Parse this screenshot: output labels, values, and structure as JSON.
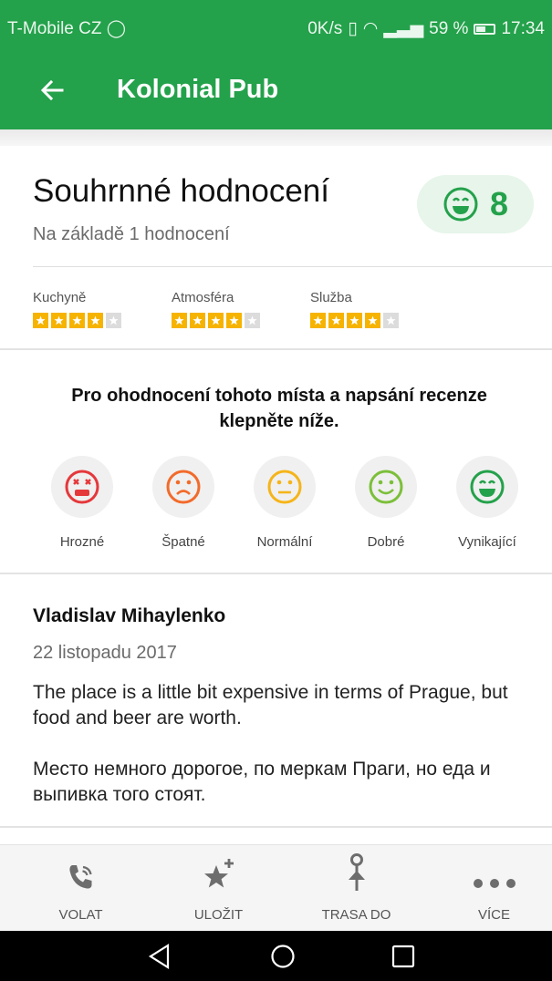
{
  "status_bar": {
    "carrier": "T-Mobile CZ",
    "right_text": "0K/s",
    "battery": "59 %",
    "time": "17:34"
  },
  "app_bar": {
    "title": "Kolonial Pub",
    "back_icon": "arrow-left-icon"
  },
  "summary": {
    "title": "Souhrnné hodnocení",
    "subtitle": "Na základě 1 hodnocení",
    "score": "8",
    "score_icon": "grinning-face-icon"
  },
  "categories": [
    {
      "label": "Kuchyně",
      "stars": 4,
      "max": 5
    },
    {
      "label": "Atmosféra",
      "stars": 4,
      "max": 5
    },
    {
      "label": "Služba",
      "stars": 4,
      "max": 5
    }
  ],
  "prompt": "Pro ohodnocení tohoto místa a napsání recenze klepněte níže.",
  "moods": [
    {
      "label": "Hrozné",
      "color": "#e5383b",
      "icon": "terrible-face-icon"
    },
    {
      "label": "Špatné",
      "color": "#f26b2b",
      "icon": "sad-face-icon"
    },
    {
      "label": "Normální",
      "color": "#f5b419",
      "icon": "neutral-face-icon"
    },
    {
      "label": "Dobré",
      "color": "#7cbf3a",
      "icon": "smile-face-icon"
    },
    {
      "label": "Vynikající",
      "color": "#24a14b",
      "icon": "grinning-face-icon"
    }
  ],
  "review": {
    "author": "Vladislav Mihaylenko",
    "date": "22 listopadu 2017",
    "text_en": "The place is a little bit expensive in terms of Prague, but food and beer are worth.",
    "text_ru": "Место немного дорогое, по меркам Праги, но еда и выпивка того стоят."
  },
  "bottom_nav": [
    {
      "label": "VOLAT",
      "icon": "phone-icon"
    },
    {
      "label": "ULOŽIT",
      "icon": "star-add-icon"
    },
    {
      "label": "TRASA DO",
      "icon": "route-pin-icon"
    },
    {
      "label": "VÍCE",
      "icon": "more-dots-icon"
    }
  ],
  "colors": {
    "accent": "#24a14b",
    "star": "#f6b300"
  }
}
